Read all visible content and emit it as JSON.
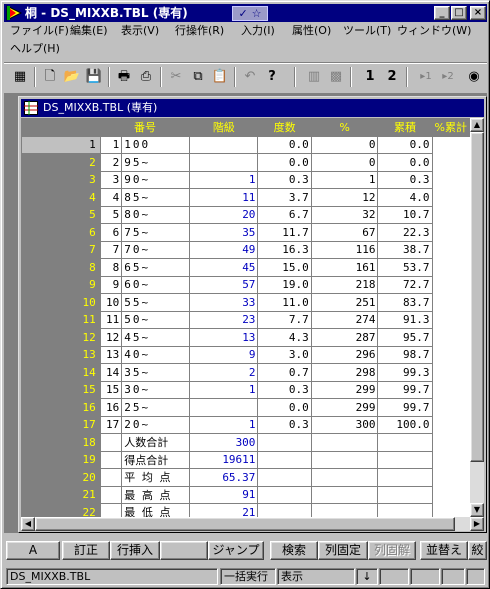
{
  "window": {
    "title": "桐 - DS_MIXXB.TBL (専有)",
    "ghost_label": "✓ ☆",
    "min_glyph": "_",
    "max_glyph": "□",
    "close_glyph": "×"
  },
  "menu": [
    "ファイル(F)",
    "編集(E)",
    "表示(V)",
    "行操作(R)",
    "入力(I)",
    "属性(O)",
    "ツール(T)",
    "ウィンドウ(W)",
    "ヘルプ(H)"
  ],
  "toolbar": [
    {
      "icon": "form-icon",
      "glyph": "▦"
    },
    {
      "icon": "new-file-icon",
      "glyph": "🗋"
    },
    {
      "icon": "open-folder-icon",
      "glyph": "📂"
    },
    {
      "icon": "save-icon",
      "glyph": "💾"
    },
    {
      "icon": "print-icon",
      "glyph": "🖶"
    },
    {
      "icon": "print-preview-icon",
      "glyph": "⎙"
    },
    {
      "icon": "cut-icon",
      "glyph": "✂"
    },
    {
      "icon": "copy-icon",
      "glyph": "⧉"
    },
    {
      "icon": "paste-icon",
      "glyph": "📋"
    },
    {
      "icon": "undo-icon",
      "glyph": "↶"
    },
    {
      "icon": "help-pointer-icon",
      "glyph": "?"
    },
    {
      "icon": "chart-icon",
      "glyph": "▥"
    },
    {
      "icon": "grid-edit-icon",
      "glyph": "▩"
    },
    {
      "icon": "view-1-icon",
      "glyph": "1"
    },
    {
      "icon": "view-2-icon",
      "glyph": "2"
    },
    {
      "icon": "next-1-icon",
      "glyph": "▸1"
    },
    {
      "icon": "next-2-icon",
      "glyph": "▸2"
    },
    {
      "icon": "circle-icon",
      "glyph": "◉"
    }
  ],
  "child": {
    "title": "DS_MIXXB.TBL (専有)"
  },
  "table": {
    "headers": [
      "番号",
      "階級",
      "度数",
      "%",
      "累積",
      "%累計"
    ],
    "rows": [
      {
        "row": "1",
        "no": "1",
        "class": "100",
        "freq": "",
        "pct": "0.0",
        "cum": "0",
        "cumpct": "0.0"
      },
      {
        "row": "2",
        "no": "2",
        "class": "95~",
        "freq": "",
        "pct": "0.0",
        "cum": "0",
        "cumpct": "0.0"
      },
      {
        "row": "3",
        "no": "3",
        "class": "90~",
        "freq": "1",
        "pct": "0.3",
        "cum": "1",
        "cumpct": "0.3"
      },
      {
        "row": "4",
        "no": "4",
        "class": "85~",
        "freq": "11",
        "pct": "3.7",
        "cum": "12",
        "cumpct": "4.0"
      },
      {
        "row": "5",
        "no": "5",
        "class": "80~",
        "freq": "20",
        "pct": "6.7",
        "cum": "32",
        "cumpct": "10.7"
      },
      {
        "row": "6",
        "no": "6",
        "class": "75~",
        "freq": "35",
        "pct": "11.7",
        "cum": "67",
        "cumpct": "22.3"
      },
      {
        "row": "7",
        "no": "7",
        "class": "70~",
        "freq": "49",
        "pct": "16.3",
        "cum": "116",
        "cumpct": "38.7"
      },
      {
        "row": "8",
        "no": "8",
        "class": "65~",
        "freq": "45",
        "pct": "15.0",
        "cum": "161",
        "cumpct": "53.7"
      },
      {
        "row": "9",
        "no": "9",
        "class": "60~",
        "freq": "57",
        "pct": "19.0",
        "cum": "218",
        "cumpct": "72.7"
      },
      {
        "row": "10",
        "no": "10",
        "class": "55~",
        "freq": "33",
        "pct": "11.0",
        "cum": "251",
        "cumpct": "83.7"
      },
      {
        "row": "11",
        "no": "11",
        "class": "50~",
        "freq": "23",
        "pct": "7.7",
        "cum": "274",
        "cumpct": "91.3"
      },
      {
        "row": "12",
        "no": "12",
        "class": "45~",
        "freq": "13",
        "pct": "4.3",
        "cum": "287",
        "cumpct": "95.7"
      },
      {
        "row": "13",
        "no": "13",
        "class": "40~",
        "freq": "9",
        "pct": "3.0",
        "cum": "296",
        "cumpct": "98.7"
      },
      {
        "row": "14",
        "no": "14",
        "class": "35~",
        "freq": "2",
        "pct": "0.7",
        "cum": "298",
        "cumpct": "99.3"
      },
      {
        "row": "15",
        "no": "15",
        "class": "30~",
        "freq": "1",
        "pct": "0.3",
        "cum": "299",
        "cumpct": "99.7"
      },
      {
        "row": "16",
        "no": "16",
        "class": "25~",
        "freq": "",
        "pct": "0.0",
        "cum": "299",
        "cumpct": "99.7"
      },
      {
        "row": "17",
        "no": "17",
        "class": "20~",
        "freq": "1",
        "pct": "0.3",
        "cum": "300",
        "cumpct": "100.0"
      }
    ],
    "summary": [
      {
        "row": "18",
        "label": "人数合計",
        "value": "300"
      },
      {
        "row": "19",
        "label": "得点合計",
        "value": "19611"
      },
      {
        "row": "20",
        "label": "平 均 点",
        "value": "65.37"
      },
      {
        "row": "21",
        "label": "最 高 点",
        "value": "91"
      },
      {
        "row": "22",
        "label": "最 低 点",
        "value": "21"
      }
    ]
  },
  "fkeys": [
    {
      "label": "A",
      "disabled": false
    },
    {
      "label": "訂正",
      "disabled": false
    },
    {
      "label": "行挿入",
      "disabled": false
    },
    {
      "label": "",
      "disabled": false
    },
    {
      "label": "ジャンプ",
      "disabled": false
    },
    {
      "label": "検索",
      "disabled": false
    },
    {
      "label": "列固定",
      "disabled": false
    },
    {
      "label": "列固解",
      "disabled": true
    },
    {
      "label": "並替え",
      "disabled": false
    },
    {
      "label": "絞",
      "disabled": false
    }
  ],
  "status": {
    "file": "DS_MIXXB.TBL",
    "batch": "一括実行",
    "mode": "表示",
    "arrow": "↓"
  },
  "colors": {
    "title_bg": "#000080",
    "header_bg": "#808080",
    "header_text": "#ffff00",
    "value_blue": "#0000c0"
  }
}
